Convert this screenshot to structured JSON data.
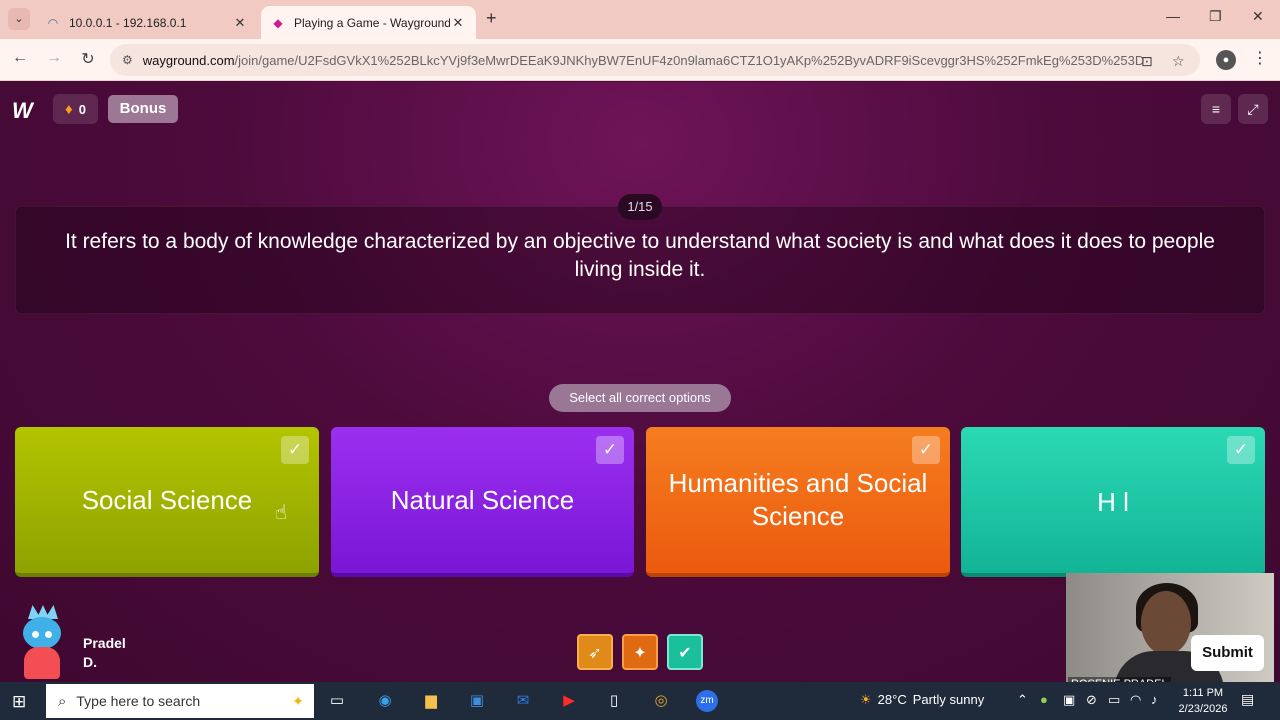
{
  "browser": {
    "tabs": [
      {
        "title": "10.0.0.1 - 192.168.0.1",
        "favicon": "wifi-icon"
      },
      {
        "title": "Playing a Game - Wayground (f",
        "favicon": "wayground-icon"
      }
    ],
    "address": {
      "host": "wayground.com",
      "path": "/join/game/U2FsdGVkX1%252BLkcYVj9f3eMwrDEEaK9JNKhyBW7EnUF4z0n9lama6CTZ1O1yAKp%252ByvADRF9iScevggr3HS%252FmkEg%253D%253D"
    }
  },
  "game": {
    "streak": "0",
    "bonus_label": "Bonus",
    "question_counter": "1/15",
    "question": "It refers to a body of knowledge characterized by an objective to understand what society is and what does it does to people living inside it.",
    "hint": "Select all correct options",
    "options": [
      {
        "label": "Social Science",
        "color": "#a3b800"
      },
      {
        "label": "Natural Science",
        "color": "#8a22e6"
      },
      {
        "label": "Humanities and Social Science",
        "color": "#f06b16"
      },
      {
        "label": "H        l",
        "color": "#1dc7a5"
      }
    ],
    "webcam_name": "ROSENIE PRADEL",
    "player": {
      "line1": "Pradel",
      "line2": "D."
    },
    "submit_label": "Submit"
  },
  "taskbar": {
    "search_placeholder": "Type here to search",
    "weather": {
      "temp": "28°C",
      "condition": "Partly sunny"
    },
    "time": "1:11 PM",
    "date": "2/23/2026"
  }
}
